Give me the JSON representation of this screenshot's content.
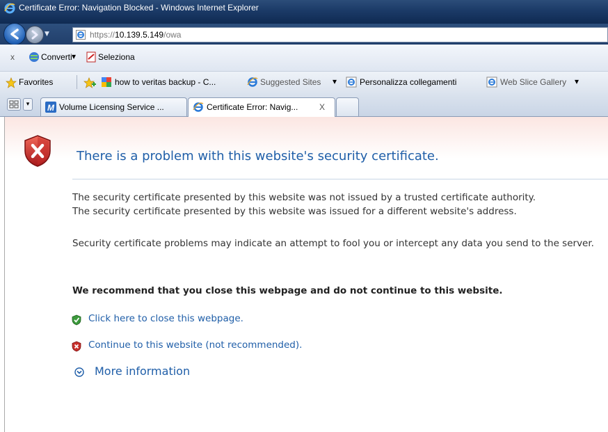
{
  "window": {
    "title": "Certificate Error: Navigation Blocked - Windows Internet Explorer"
  },
  "address_bar": {
    "url_prefix": "https://",
    "url_host": "10.139.5.149",
    "url_path": "/owa"
  },
  "command_bar": {
    "close_glyph": "x",
    "convert_label": "Converti",
    "convert_dropdown": "▾",
    "select_label": "Seleziona"
  },
  "favorites_bar": {
    "favorites_label": "Favorites",
    "items": [
      {
        "label": "how to veritas backup - C...",
        "icon": "google-icon"
      },
      {
        "label": "Suggested Sites",
        "icon": "ie-icon",
        "dropdown": "▾"
      },
      {
        "label": "Personalizza collegamenti",
        "icon": "ie-icon"
      },
      {
        "label": "Web Slice Gallery",
        "icon": "ie-icon",
        "dropdown": "▾"
      }
    ]
  },
  "tabs": [
    {
      "label": "Volume Licensing Service ...",
      "icon": "m-icon",
      "active": false
    },
    {
      "label": "Certificate Error: Navig...",
      "icon": "ie-icon",
      "active": true,
      "close": "X"
    }
  ],
  "tab_list_dropdown": "▾",
  "page": {
    "heading": "There is a problem with this website's security certificate.",
    "line1": "The security certificate presented by this website was not issued by a trusted certificate authority.",
    "line2": "The security certificate presented by this website was issued for a different website's address.",
    "paragraph2": "Security certificate problems may indicate an attempt to fool you or intercept any data you send to the server.",
    "recommend": "We recommend that you close this webpage and do not continue to this website.",
    "close_link": "Click here to close this webpage.",
    "continue_link": "Continue to this website (not recommended).",
    "more_info": "More information"
  },
  "colors": {
    "link_blue": "#1f5ea8",
    "titlebar_dark": "#1b3a67",
    "content_tint": "#fbe6e2"
  }
}
